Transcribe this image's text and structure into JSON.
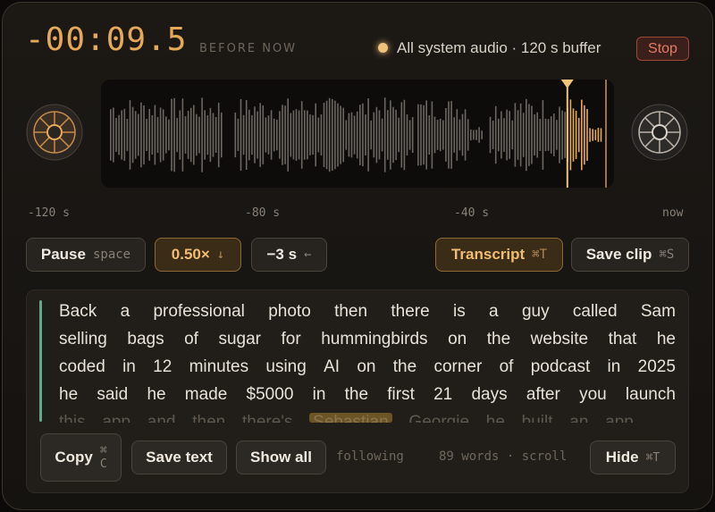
{
  "header": {
    "offset": "-00:09.5",
    "offset_label": "BEFORE NOW",
    "source": "All system audio · 120 s buffer",
    "stop_label": "Stop",
    "recording_color": "#f0c27a"
  },
  "timeline": {
    "ticks": [
      "-120 s",
      "-80 s",
      "-40 s",
      "now"
    ],
    "playhead_fraction": 0.909,
    "played_color": "#e6a95a",
    "unplayed_color": "#6b6660"
  },
  "controls": {
    "pause_label": "Pause",
    "pause_key": "space",
    "speed_label": "0.50×",
    "speed_icon": "arrow-down-icon",
    "skip_label": "−3 s",
    "skip_icon": "arrow-left-icon",
    "transcript_label": "Transcript",
    "transcript_key": "⌘T",
    "save_clip_label": "Save clip",
    "save_clip_key": "⌘S"
  },
  "transcript": {
    "lines": [
      [
        "Back",
        "a",
        "professional",
        "photo",
        "then",
        "there",
        "is",
        "a",
        "guy",
        "called",
        "Sam"
      ],
      [
        "selling",
        "bags",
        "of",
        "sugar",
        "for",
        "hummingbirds",
        "on",
        "the",
        "website",
        "that",
        "he"
      ],
      [
        "coded",
        "in",
        "12",
        "minutes",
        "using",
        "AI",
        "on",
        "the",
        "corner",
        "of",
        "podcast",
        "in",
        "2025"
      ],
      [
        "he",
        "said",
        "he",
        "made",
        "$5000",
        "in",
        "the",
        "first",
        "21",
        "days",
        "after",
        "you",
        "launch"
      ]
    ],
    "partial_line": [
      "this",
      "app",
      "and",
      "then",
      "there's"
    ],
    "partial_highlight": "Sebastian",
    "partial_tail": [
      "Georgie",
      "he",
      "built",
      "an",
      "app"
    ],
    "accent_color": "#5fa88a"
  },
  "footer": {
    "copy_label": "Copy",
    "copy_key_1": "⌘",
    "copy_key_2": "C",
    "save_text_label": "Save text",
    "show_all_label": "Show all",
    "following": "following",
    "word_count": "89 words · scroll",
    "hide_label": "Hide",
    "hide_key": "⌘T"
  }
}
